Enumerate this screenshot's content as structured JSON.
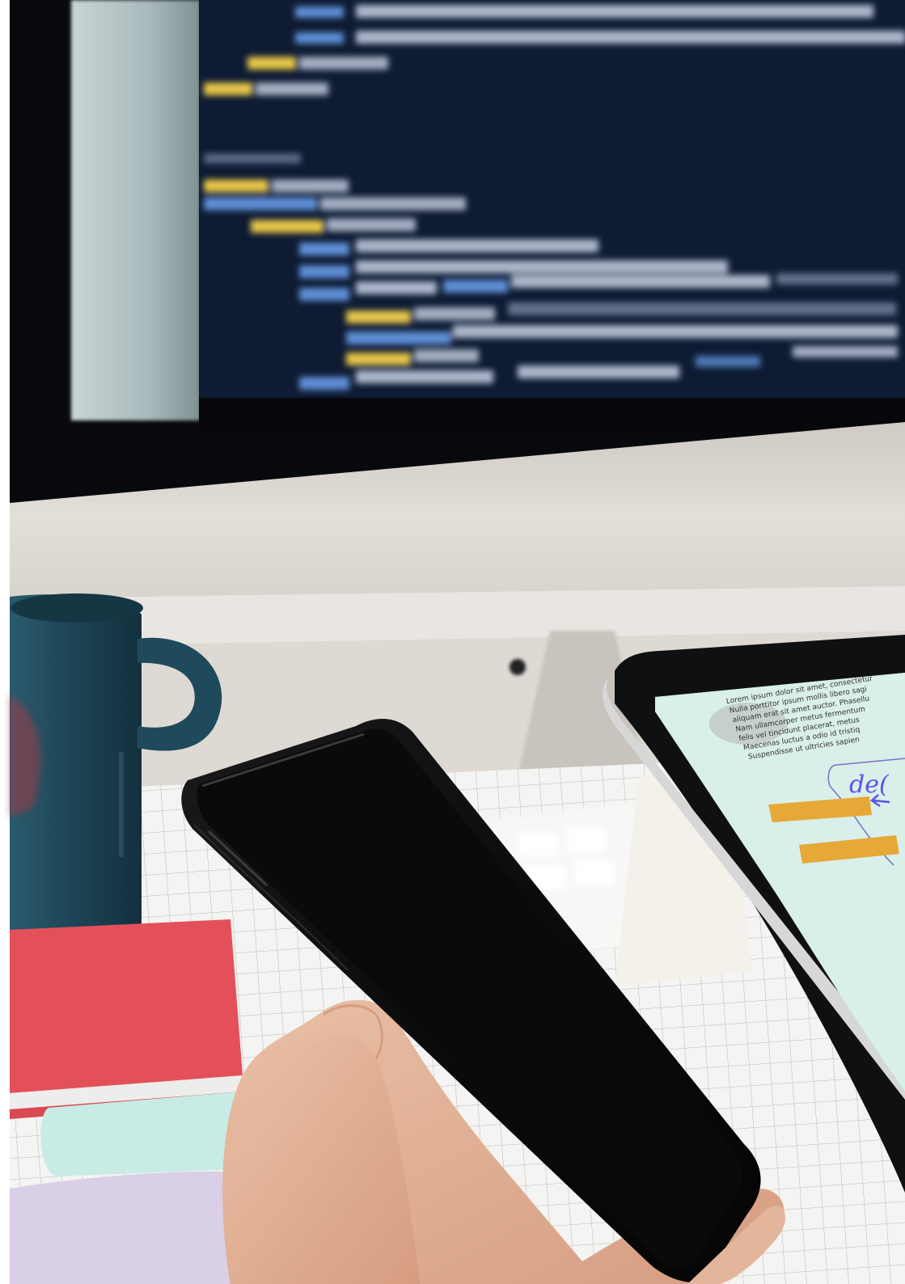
{
  "scene": {
    "alt": "Workspace photo: a monitor showing code, a dark mug, a smartphone held in hand, and a tablet with notes on a grid desk mat",
    "colors": {
      "editor_bg": "#0e1b33",
      "keyword": "#e7c64a",
      "identifier": "#5f8fd6",
      "plain": "#c9d3e6",
      "bezel": "#07090c",
      "monitor_chin": "#dcd8d2",
      "mug": "#1f4a5c",
      "phone": "#0a0a0b",
      "tablet_screen": "#d9efe9",
      "notebook": "#e4505a",
      "highlighter_bar": "#e6a938",
      "handwriting": "#5b53e8",
      "skin": "#e0b296"
    },
    "tablet": {
      "lorem_lines": [
        "Lorem ipsum dolor sit amet, consectetur",
        "Nulla porttitor ipsum mollis libero sagi",
        "aliquam erat sit amet auctor. Phasellu",
        "Nam ullamcorper metus fermentum",
        "felis vel tincidunt placerat, metus",
        "Maecenas luctus a odio id tristiq",
        "Suspendisse ut ultricies sapien"
      ],
      "handwriting": "de("
    }
  }
}
